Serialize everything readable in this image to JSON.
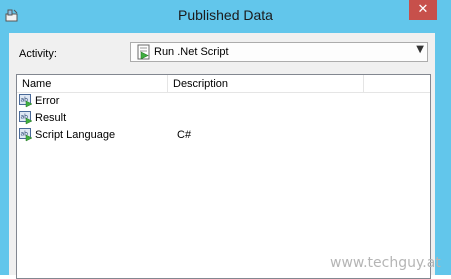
{
  "window": {
    "title": "Published Data",
    "close_glyph": "✕"
  },
  "activity": {
    "label": "Activity:",
    "selected": "Run .Net Script",
    "icon": "run-script-icon"
  },
  "list": {
    "columns": [
      "Name",
      "Description"
    ],
    "rows": [
      {
        "name": "Error",
        "description": ""
      },
      {
        "name": "Result",
        "description": ""
      },
      {
        "name": "Script Language",
        "description": "C#"
      }
    ]
  },
  "watermark": "www.techguy.at",
  "colors": {
    "titlebar": "#62c6eb",
    "close": "#c7504b",
    "client": "#f0f0f0"
  }
}
